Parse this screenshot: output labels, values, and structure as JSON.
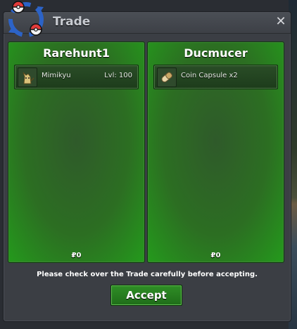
{
  "window": {
    "title": "Trade",
    "close_label": "✕"
  },
  "left_panel": {
    "player": "Rarehunt1",
    "items": [
      {
        "name": "Mimikyu",
        "level": "Lvl: 100",
        "icon": "mimikyu-icon"
      }
    ],
    "money": "₽0"
  },
  "right_panel": {
    "player": "Ducmucer",
    "items": [
      {
        "name": "Coin Capsule  x2",
        "icon": "coin-capsule-icon"
      }
    ],
    "money": "₽0"
  },
  "footer": {
    "notice": "Please check over the Trade carefully before accepting.",
    "accept_label": "Accept"
  },
  "colors": {
    "panel_green": "#2c6e22",
    "accept_green": "#1f6d19",
    "dialog_bg": "#3b3e44"
  }
}
